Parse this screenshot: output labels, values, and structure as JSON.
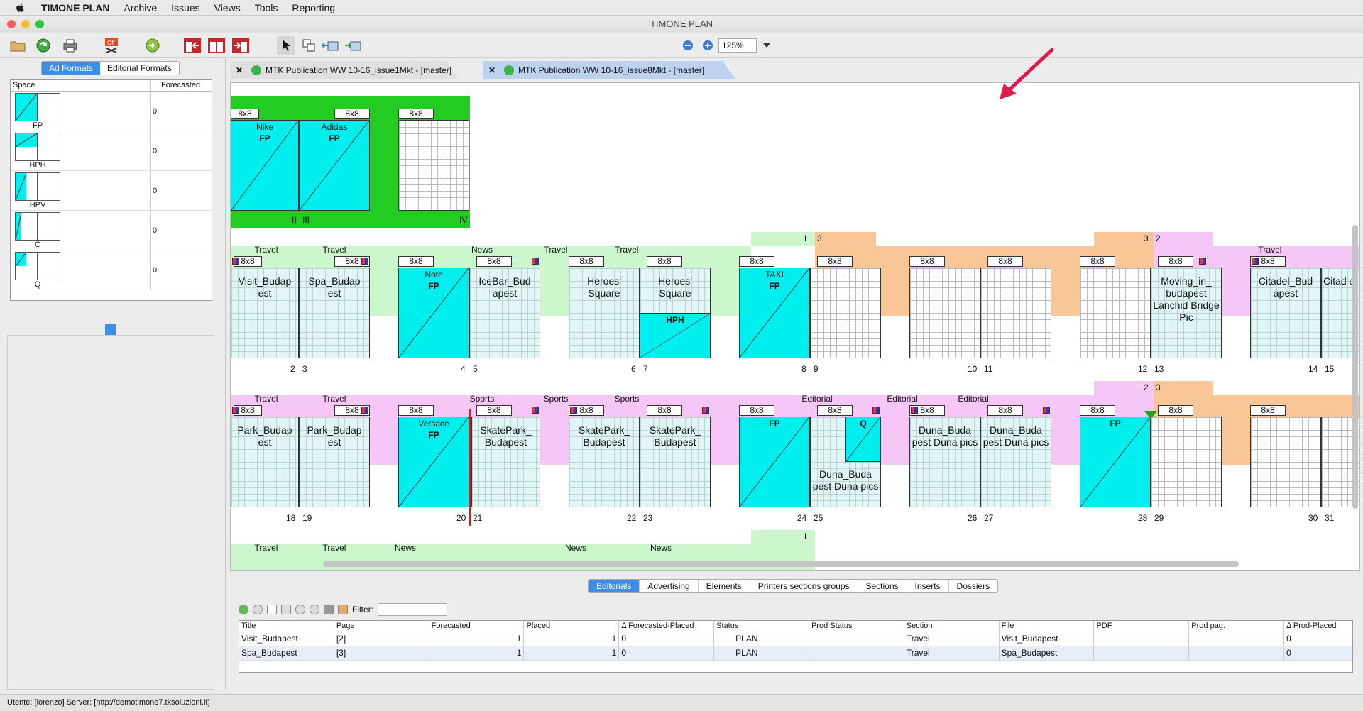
{
  "menubar": {
    "app": "TIMONE PLAN",
    "items": [
      "Archive",
      "Issues",
      "Views",
      "Tools",
      "Reporting"
    ]
  },
  "window": {
    "title": "TIMONE PLAN"
  },
  "toolbar": {
    "zoom": "125%"
  },
  "left_panel": {
    "tabs": [
      "Ad Formats",
      "Editorial Formats"
    ],
    "columns": [
      "Space",
      "Forecasted"
    ],
    "rows": [
      {
        "label": "FP",
        "value": "0"
      },
      {
        "label": "HPH",
        "value": "0"
      },
      {
        "label": "HPV",
        "value": "0"
      },
      {
        "label": "C",
        "value": "0"
      },
      {
        "label": "Q",
        "value": "0"
      }
    ]
  },
  "doc_tabs": [
    "MTK Publication WW 10-16_issue1Mkt - [master]",
    "MTK Publication WW 10-16_issue8Mkt - [master]"
  ],
  "flatplan": {
    "fmt": "8x8",
    "sections": {
      "travel": "Travel",
      "news": "News",
      "sports": "Sports",
      "editorial": "Editorial"
    },
    "ads": {
      "nike": "Nike",
      "adidas": "Adidas",
      "fp": "FP",
      "note": "Note",
      "taxi": "TAXI",
      "hph": "HPH",
      "versace": "Versace",
      "q": "Q"
    },
    "cover_nums": [
      "II",
      "III",
      "IV"
    ],
    "counts": [
      "1",
      "3",
      "3",
      "2",
      "2",
      "3",
      "1"
    ],
    "titles": {
      "visit": "Visit_Budap est",
      "spa": "Spa_Budap est",
      "icebar": "IceBar_Bud apest",
      "heroes": "Heroes' Square",
      "moving": "Moving_in_ budapest Lánchid Bridge Pic",
      "citadel": "Citadel_Bud apest",
      "citadel2": "Citad a",
      "park": "Park_Budap est",
      "skate": "SkatePark_ Budapest",
      "duna": "Duna_Buda pest Duna pics"
    },
    "row1_nums": [
      "2",
      "3",
      "4",
      "5",
      "6",
      "7",
      "8",
      "9",
      "10",
      "11",
      "12",
      "13",
      "14",
      "15"
    ],
    "row2_nums": [
      "18",
      "19",
      "20",
      "21",
      "22",
      "23",
      "24",
      "25",
      "26",
      "27",
      "28",
      "29",
      "30",
      "31"
    ]
  },
  "bottom": {
    "tabs": [
      "Editorials",
      "Advertising",
      "Elements",
      "Printers sections groups",
      "Sections",
      "Inserts",
      "Dossiers"
    ],
    "filter_label": "Filter:",
    "columns": [
      "Title",
      "Page",
      "Forecasted",
      "Placed",
      "Δ Forecasted-Placed",
      "Status",
      "Prod Status",
      "Section",
      "File",
      "PDF",
      "Prod pag.",
      "Δ Prod-Placed"
    ],
    "rows": [
      [
        "Visit_Budapest",
        "[2]",
        "1",
        "1",
        "0",
        "PLAN",
        "",
        "Travel",
        "Visit_Budapest",
        "",
        "",
        "0"
      ],
      [
        "Spa_Budapest",
        "[3]",
        "1",
        "1",
        "0",
        "PLAN",
        "",
        "Travel",
        "Spa_Budapest",
        "",
        "",
        "0"
      ]
    ]
  },
  "status": {
    "text": "Utente: [lorenzo]    Server: [http://demotimone7.tksoluzioni.it]"
  },
  "colors": {
    "accent": "#3d8ee6",
    "ad": "#00eeee",
    "travel": "#ccf7cc",
    "orange": "#f9c797",
    "pink": "#f6c7f6",
    "cover": "#22cc22"
  }
}
